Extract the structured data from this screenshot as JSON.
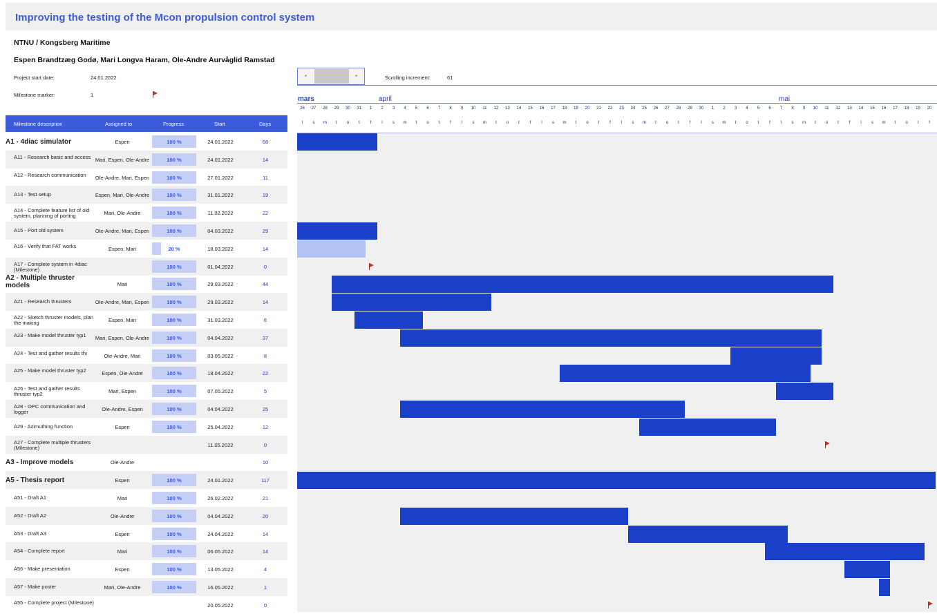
{
  "title": "Improving the testing of the Mcon propulsion control system",
  "organization": "NTNU / Kongsberg Maritime",
  "authors": "Espen Brandtzæg Godø, Mari Longva Haram, Ole-Andre Aurvåglid Ramstad",
  "settings": {
    "project_start_label": "Project start date:",
    "project_start_value": "24.01.2022",
    "milestone_marker_label": "Milestone marker:",
    "milestone_marker_value": "1",
    "scrolling_increment_label": "Scrolling increment:",
    "scrolling_increment_value": "61"
  },
  "timeline": {
    "months": [
      "mars",
      "april",
      "mai"
    ],
    "day_numbers": [
      "26",
      "27",
      "28",
      "29",
      "30",
      "31",
      "1",
      "2",
      "3",
      "4",
      "5",
      "6",
      "7",
      "8",
      "9",
      "10",
      "11",
      "12",
      "13",
      "14",
      "15",
      "16",
      "17",
      "18",
      "19",
      "20",
      "21",
      "22",
      "23",
      "24",
      "25",
      "26",
      "27",
      "28",
      "29",
      "30",
      "1",
      "2",
      "3",
      "4",
      "5",
      "6",
      "7",
      "8",
      "9",
      "10",
      "11",
      "12",
      "13",
      "14",
      "15",
      "16",
      "17",
      "18",
      "19",
      "20"
    ],
    "day_letters": [
      "l",
      "s",
      "m",
      "t",
      "o",
      "t",
      "f",
      "l",
      "s",
      "m",
      "t",
      "o",
      "t",
      "f",
      "l",
      "s",
      "m",
      "t",
      "o",
      "t",
      "f",
      "l",
      "s",
      "m",
      "t",
      "o",
      "t",
      "f",
      "l",
      "s",
      "m",
      "t",
      "o",
      "t",
      "f",
      "l",
      "s",
      "m",
      "t",
      "o",
      "t",
      "f",
      "l",
      "s",
      "m",
      "t",
      "o",
      "t",
      "f",
      "l",
      "s",
      "m",
      "t",
      "o",
      "t",
      "f"
    ]
  },
  "columns": {
    "desc": "Milestone description",
    "assigned": "Assigned to",
    "progress": "Progress",
    "start": "Start",
    "days": "Days"
  },
  "colors": {
    "accent": "#3b5bdb",
    "bar": "#1a3fc8",
    "bar_light": "#b3c2f2",
    "flag": "#c0392b"
  },
  "rows": [
    {
      "desc": "A1 - 4diac simulator",
      "style": "bold",
      "assigned": "Espen",
      "progress": "100 %",
      "progress_fraction": 1.0,
      "start": "24.01.2022",
      "days": "68"
    },
    {
      "desc": "A11 - Research basic and access",
      "assigned": "Mari, Espen, Ole-Andre",
      "progress": "100 %",
      "progress_fraction": 1.0,
      "start": "24.01.2022",
      "days": "14"
    },
    {
      "desc": "A12 - Research communication",
      "assigned": "Ole-Andre, Mari, Espen",
      "progress": "100 %",
      "progress_fraction": 1.0,
      "start": "27.01.2022",
      "days": "11"
    },
    {
      "desc": "A13 - Test setup",
      "assigned": "Espen, Mari, Ole-Andre",
      "progress": "100 %",
      "progress_fraction": 1.0,
      "start": "31.01.2022",
      "days": "19"
    },
    {
      "desc": "A14 - Complete feature list of old system, planning of porting",
      "assigned": "Mari, Ole-Andre",
      "progress": "100 %",
      "progress_fraction": 1.0,
      "start": "11.02.2022",
      "days": "22"
    },
    {
      "desc": "A15 - Port old system",
      "assigned": "Ole-Andre, Mari, Espen",
      "progress": "100 %",
      "progress_fraction": 1.0,
      "start": "04.03.2022",
      "days": "29"
    },
    {
      "desc": "A16 - Verify that FAT works",
      "assigned": "Espen, Mari",
      "progress": "20 %",
      "progress_fraction": 0.2,
      "start": "18.03.2022",
      "days": "14"
    },
    {
      "desc": "A17 - Complete system in 4diac (Milestone)",
      "assigned": "",
      "progress": "100 %",
      "progress_fraction": 1.0,
      "start": "01.04.2022",
      "days": "0"
    },
    {
      "desc": "A2 - Multiple thruster models",
      "style": "bold2",
      "assigned": "Mari",
      "progress": "100 %",
      "progress_fraction": 1.0,
      "start": "29.03.2022",
      "days": "44"
    },
    {
      "desc": "A21 - Research thrusters",
      "assigned": "Ole-Andre, Mari, Espen",
      "progress": "100 %",
      "progress_fraction": 1.0,
      "start": "29.03.2022",
      "days": "14"
    },
    {
      "desc": "A22 - Sketch thruster models, plan the making",
      "assigned": "Espen, Mari",
      "progress": "100 %",
      "progress_fraction": 1.0,
      "start": "31.03.2022",
      "days": "6"
    },
    {
      "desc": "A23 - Make model thruster typ1",
      "assigned": "Mari, Espen, Ole-Andre",
      "progress": "100 %",
      "progress_fraction": 1.0,
      "start": "04.04.2022",
      "days": "37"
    },
    {
      "desc": "A24 - Test and gather results thı",
      "assigned": "Ole-Andre, Mari",
      "progress": "100 %",
      "progress_fraction": 1.0,
      "start": "03.05.2022",
      "days": "8"
    },
    {
      "desc": "A25 - Make model thruster typ2",
      "assigned": "Espen, Ole-Andre",
      "progress": "100 %",
      "progress_fraction": 1.0,
      "start": "18.04.2022",
      "days": "22"
    },
    {
      "desc": "A26 -  Test and gather results thruster typ2",
      "assigned": "Mari, Espen",
      "progress": "100 %",
      "progress_fraction": 1.0,
      "start": "07.05.2022",
      "days": "5"
    },
    {
      "desc": "A28 - OPC communication and logger",
      "assigned": "Ole-Andre, Espen",
      "progress": "100 %",
      "progress_fraction": 1.0,
      "start": "04.04.2022",
      "days": "25"
    },
    {
      "desc": "A29 - Azimuthing function",
      "assigned": "Espen",
      "progress": "100 %",
      "progress_fraction": 1.0,
      "start": "25.04.2022",
      "days": "12"
    },
    {
      "desc": "A27 - Complete multiple thrusters (Milestone)",
      "assigned": "",
      "progress": "",
      "progress_fraction": 0,
      "start": "11.05.2022",
      "days": "0"
    },
    {
      "desc": "A3 - Improve models",
      "style": "bold",
      "assigned": "Ole-Andre",
      "progress": "",
      "progress_fraction": 0,
      "start": "",
      "days": "10"
    },
    {
      "desc": "A5 - Thesis report",
      "style": "bold",
      "assigned": "Espen",
      "progress": "100 %",
      "progress_fraction": 1.0,
      "start": "24.01.2022",
      "days": "117"
    },
    {
      "desc": "A51 - Draft A1",
      "assigned": "Mari",
      "progress": "100 %",
      "progress_fraction": 1.0,
      "start": "26.02.2022",
      "days": "21"
    },
    {
      "desc": "A52 - Draft A2",
      "assigned": "Ole-Andre",
      "progress": "100 %",
      "progress_fraction": 1.0,
      "start": "04.04.2022",
      "days": "20"
    },
    {
      "desc": "A53 - Draft A3",
      "assigned": "Espen",
      "progress": "100 %",
      "progress_fraction": 1.0,
      "start": "24.04.2022",
      "days": "14"
    },
    {
      "desc": "A54 - Complete report",
      "assigned": "Mari",
      "progress": "100 %",
      "progress_fraction": 1.0,
      "start": "06.05.2022",
      "days": "14"
    },
    {
      "desc": "A56 - Make presentation",
      "assigned": "Espen",
      "progress": "100 %",
      "progress_fraction": 1.0,
      "start": "13.05.2022",
      "days": "4"
    },
    {
      "desc": "A57 - Make poster",
      "assigned": "Mari, Ole-Andre",
      "progress": "100 %",
      "progress_fraction": 1.0,
      "start": "16.05.2022",
      "days": "1"
    },
    {
      "desc": "A55 - Complete project (Milestone)",
      "assigned": "",
      "progress": "",
      "progress_fraction": 0,
      "start": "20.05.2022",
      "days": "0"
    }
  ]
}
